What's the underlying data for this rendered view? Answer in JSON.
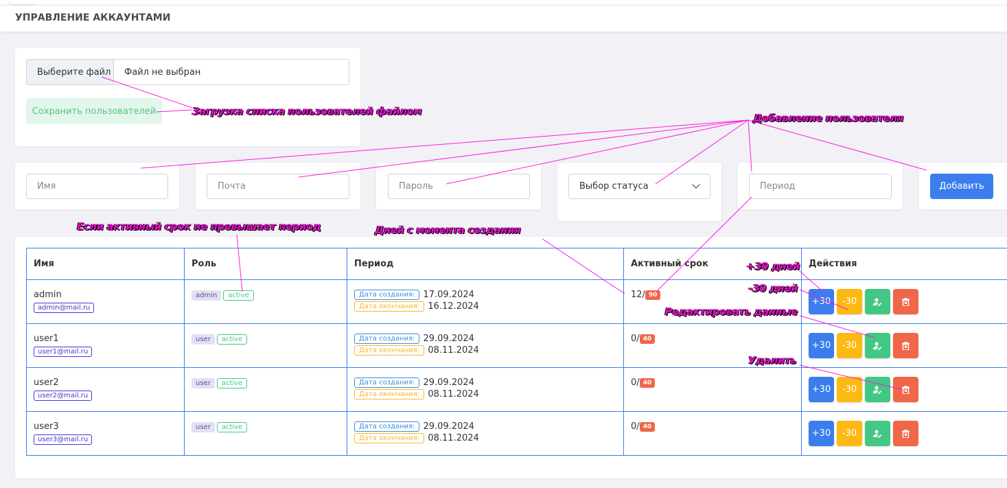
{
  "header": {
    "title": "УПРАВЛЕНИЕ АККАУНТАМИ"
  },
  "upload": {
    "choose_file": "Выберите файл",
    "no_file": "Файл не выбран",
    "save_users": "Сохранить пользователей"
  },
  "add_form": {
    "name_placeholder": "Имя",
    "email_placeholder": "Почта",
    "password_placeholder": "Пароль",
    "status_select": "Выбор статуса",
    "period_placeholder": "Период",
    "add_button": "Добавить"
  },
  "table": {
    "headers": [
      "Имя",
      "Роль",
      "Период",
      "Активный срок",
      "Действия"
    ],
    "created_label": "Дата создания:",
    "end_label": "Дата окончания:",
    "action_plus": "+30",
    "action_minus": "-30",
    "rows": [
      {
        "name": "admin",
        "email": "admin@mail.ru",
        "role": "admin",
        "status": "active",
        "created": "17.09.2024",
        "ends": "16.12.2024",
        "active_days": "12/",
        "period": "90"
      },
      {
        "name": "user1",
        "email": "user1@mail.ru",
        "role": "user",
        "status": "active",
        "created": "29.09.2024",
        "ends": "08.11.2024",
        "active_days": "0/",
        "period": "40"
      },
      {
        "name": "user2",
        "email": "user2@mail.ru",
        "role": "user",
        "status": "active",
        "created": "29.09.2024",
        "ends": "08.11.2024",
        "active_days": "0/",
        "period": "40"
      },
      {
        "name": "user3",
        "email": "user3@mail.ru",
        "role": "user",
        "status": "active",
        "created": "29.09.2024",
        "ends": "08.11.2024",
        "active_days": "0/",
        "period": "40"
      }
    ]
  },
  "annotations": {
    "file_upload": "Загрузка списка пользователей файлом",
    "add_user": "Добавление пользователя",
    "if_active": "Если активный срок не превышает период",
    "days_since": "Дней с момента создания",
    "plus30": "+30 дней",
    "minus30": "-30 дней",
    "edit": "Редактировать данные",
    "delete": "Удалить"
  },
  "colors": {
    "primary": "#3b7ded",
    "success": "#43c784",
    "warning": "#fdb913",
    "danger": "#f06648",
    "annotation": "#e010c8"
  }
}
